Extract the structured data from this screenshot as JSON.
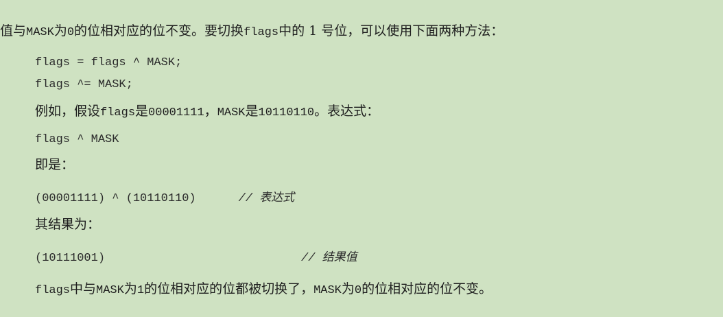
{
  "paragraph_top": {
    "t1": "值与",
    "t2": "MASK",
    "t3": "为",
    "t4": "0",
    "t5": "的位相对应的位不变。要切换",
    "t6": "flags",
    "t7": "中的 1 号位，可以使用下面两种方法："
  },
  "code1": "flags = flags ^ MASK;",
  "code2": "flags ^= MASK;",
  "example": {
    "t1": "例如，假设",
    "t2": "flags",
    "t3": "是",
    "t4": "00001111",
    "t5": "，",
    "t6": "MASK",
    "t7": "是",
    "t8": "10110110",
    "t9": "。表达式："
  },
  "code3": "flags ^ MASK",
  "that_is": "即是：",
  "code4": {
    "expr": "(00001111) ^ (10110110)",
    "comment": "// 表达式"
  },
  "result_label": "其结果为：",
  "code5": {
    "expr": "(10111001)",
    "comment": "// 结果值"
  },
  "conclusion": {
    "t1": "flags",
    "t2": "中与",
    "t3": "MASK",
    "t4": "为",
    "t5": "1",
    "t6": "的位相对应的位都被切换了，",
    "t7": "MASK",
    "t8": "为",
    "t9": "0",
    "t10": "的位相对应的位不变。"
  }
}
